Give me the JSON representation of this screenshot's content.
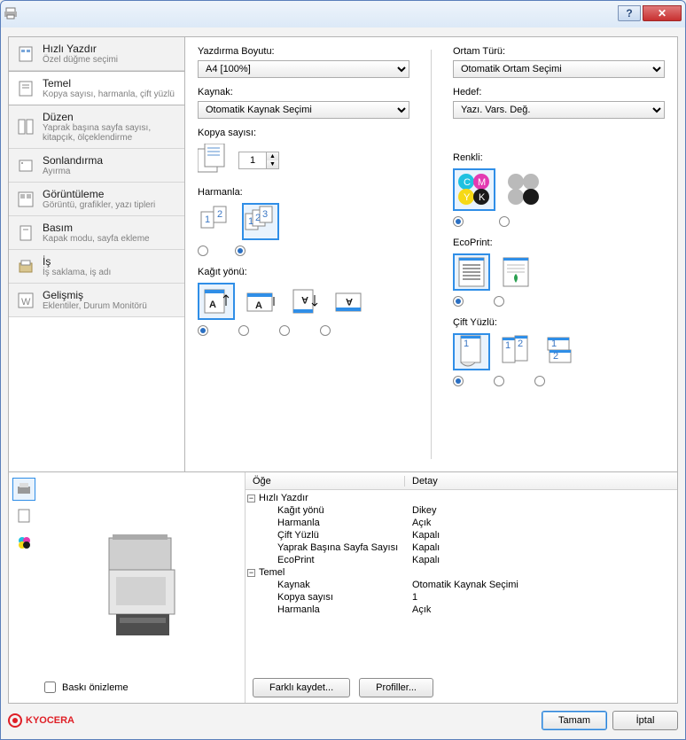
{
  "titlebar": {
    "title": ""
  },
  "tabs": [
    {
      "key": "quick",
      "t1": "Hızlı Yazdır",
      "t2": "Özel düğme seçimi"
    },
    {
      "key": "basic",
      "t1": "Temel",
      "t2": "Kopya sayısı, harmanla, çift yüzlü"
    },
    {
      "key": "layout",
      "t1": "Düzen",
      "t2": "Yaprak başına sayfa sayısı, kitapçık, ölçeklendirme"
    },
    {
      "key": "finish",
      "t1": "Sonlandırma",
      "t2": "Ayırma"
    },
    {
      "key": "imaging",
      "t1": "Görüntüleme",
      "t2": "Görüntü, grafikler, yazı tipleri"
    },
    {
      "key": "publish",
      "t1": "Basım",
      "t2": "Kapak modu, sayfa ekleme"
    },
    {
      "key": "job",
      "t1": "İş",
      "t2": "İş saklama, iş adı"
    },
    {
      "key": "advanced",
      "t1": "Gelişmiş",
      "t2": "Eklentiler, Durum Monitörü"
    }
  ],
  "selectedTab": "basic",
  "left": {
    "printSizeLabel": "Yazdırma Boyutu:",
    "printSizeValue": "A4  [100%]",
    "sourceLabel": "Kaynak:",
    "sourceValue": "Otomatik Kaynak Seçimi",
    "copiesLabel": "Kopya sayısı:",
    "copiesValue": "1",
    "collateLabel": "Harmanla:",
    "orientationLabel": "Kağıt yönü:"
  },
  "right": {
    "mediaTypeLabel": "Ortam Türü:",
    "mediaTypeValue": "Otomatik Ortam Seçimi",
    "destLabel": "Hedef:",
    "destValue": "Yazı. Vars. Değ.",
    "colorLabel": "Renkli:",
    "ecoLabel": "EcoPrint:",
    "duplexLabel": "Çift Yüzlü:"
  },
  "grid": {
    "col1": "Öğe",
    "col2": "Detay",
    "rows": [
      {
        "type": "group",
        "label": "Hızlı Yazdır"
      },
      {
        "type": "item",
        "label": "Kağıt yönü",
        "value": "Dikey"
      },
      {
        "type": "item",
        "label": "Harmanla",
        "value": "Açık"
      },
      {
        "type": "item",
        "label": "Çift Yüzlü",
        "value": "Kapalı"
      },
      {
        "type": "item",
        "label": "Yaprak Başına Sayfa Sayısı",
        "value": "Kapalı"
      },
      {
        "type": "item",
        "label": "EcoPrint",
        "value": "Kapalı"
      },
      {
        "type": "group",
        "label": "Temel"
      },
      {
        "type": "item",
        "label": "Kaynak",
        "value": "Otomatik Kaynak Seçimi"
      },
      {
        "type": "item",
        "label": "Kopya sayısı",
        "value": "1"
      },
      {
        "type": "item",
        "label": "Harmanla",
        "value": "Açık"
      }
    ]
  },
  "buttons": {
    "saveAs": "Farklı kaydet...",
    "profiles": "Profiller...",
    "ok": "Tamam",
    "cancel": "İptal",
    "previewChk": "Baskı önizleme"
  },
  "brand": "KYOCERA"
}
